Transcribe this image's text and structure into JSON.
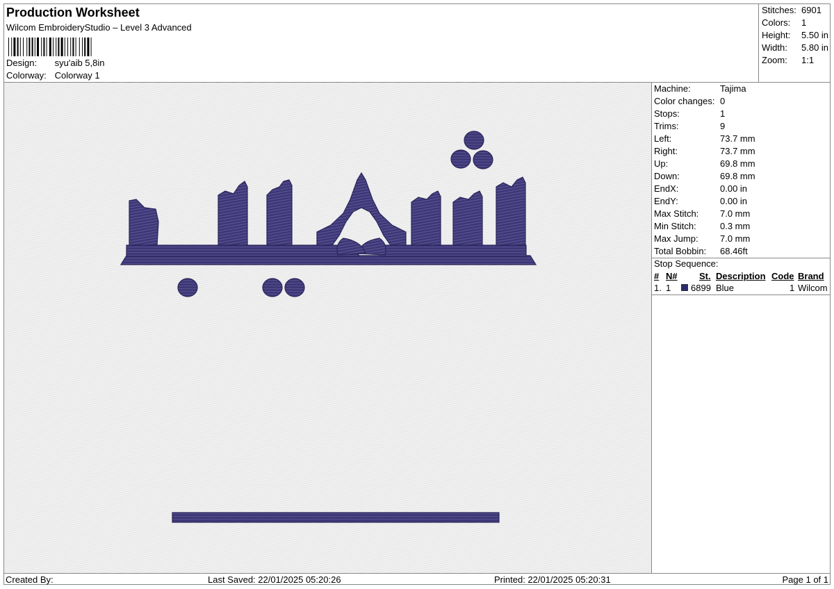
{
  "header": {
    "title": "Production Worksheet",
    "subtitle": "Wilcom EmbroideryStudio – Level 3 Advanced",
    "design_label": "Design:",
    "design_value": "syu'aib 5,8in",
    "colorway_label": "Colorway:",
    "colorway_value": "Colorway 1"
  },
  "stats": [
    {
      "label": "Stitches:",
      "value": "6901"
    },
    {
      "label": "Colors:",
      "value": "1"
    },
    {
      "label": "Height:",
      "value": "5.50 in"
    },
    {
      "label": "Width:",
      "value": "5.80 in"
    },
    {
      "label": "Zoom:",
      "value": "1:1"
    }
  ],
  "machine_info": [
    {
      "label": "Machine:",
      "value": "Tajima"
    },
    {
      "label": "Color changes:",
      "value": "0"
    },
    {
      "label": "Stops:",
      "value": "1"
    },
    {
      "label": "Trims:",
      "value": "9"
    },
    {
      "label": "Left:",
      "value": "73.7 mm"
    },
    {
      "label": "Right:",
      "value": "73.7 mm"
    },
    {
      "label": "Up:",
      "value": "69.8 mm"
    },
    {
      "label": "Down:",
      "value": "69.8 mm"
    },
    {
      "label": "EndX:",
      "value": "0.00 in"
    },
    {
      "label": "EndY:",
      "value": "0.00 in"
    },
    {
      "label": "Max Stitch:",
      "value": "7.0 mm"
    },
    {
      "label": "Min Stitch:",
      "value": "0.3 mm"
    },
    {
      "label": "Max Jump:",
      "value": "7.0 mm"
    },
    {
      "label": "Total Bobbin:",
      "value": "68.46ft"
    }
  ],
  "stop_sequence": {
    "title": "Stop Sequence:",
    "columns": [
      "#",
      "N#",
      "St.",
      "Description",
      "Code",
      "Brand"
    ],
    "rows": [
      {
        "index": "1.",
        "n": "1",
        "stitch": "6899",
        "description": "Blue",
        "code": "1",
        "brand": "Wilcom",
        "swatch_color": "#2e2a6e"
      }
    ]
  },
  "footer": {
    "created_by": "Created By:",
    "last_saved": "Last Saved: 22/01/2025 05:20:26",
    "printed": "Printed: 22/01/2025 05:20:31",
    "page": "Page 1 of 1"
  },
  "colors": {
    "thread": "#3d3775",
    "thread_dark": "#2a2558",
    "canvas_bg": "#e9e9e9"
  }
}
